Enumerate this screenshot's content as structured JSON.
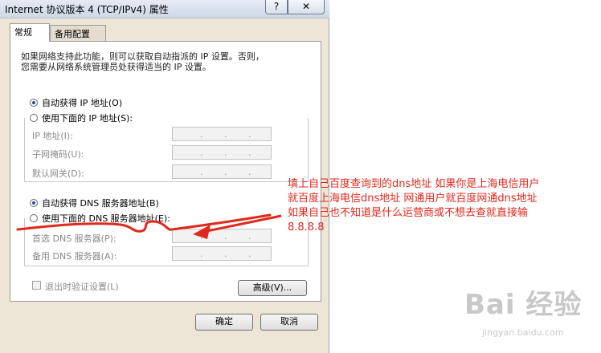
{
  "window": {
    "title": "Internet 协议版本 4 (TCP/IPv4) 属性",
    "help_glyph": "?",
    "close_glyph": "✕"
  },
  "tabs": [
    {
      "label": "常规",
      "active": true
    },
    {
      "label": "备用配置",
      "active": false
    }
  ],
  "description": {
    "line1": "如果网络支持此功能，则可以获取自动指派的 IP 设置。否则，",
    "line2": "您需要从网络系统管理员处获得适当的 IP 设置。"
  },
  "ip_section": {
    "auto_label": "自动获得 IP 地址(O)",
    "auto_selected": true,
    "manual_label": "使用下面的 IP 地址(S):",
    "manual_selected": false,
    "fields": [
      {
        "label": "IP 地址(I):"
      },
      {
        "label": "子网掩码(U):"
      },
      {
        "label": "默认网关(D):"
      }
    ]
  },
  "dns_section": {
    "auto_label": "自动获得 DNS 服务器地址(B)",
    "auto_selected": true,
    "manual_label": "使用下面的 DNS 服务器地址(E):",
    "manual_selected": false,
    "fields": [
      {
        "label": "首选 DNS 服务器(P):"
      },
      {
        "label": "备用 DNS 服务器(A):"
      }
    ]
  },
  "validate": {
    "label": "退出时验证设置(L)",
    "checked": false
  },
  "buttons": {
    "advanced": "高级(V)...",
    "ok": "确定",
    "cancel": "取消"
  },
  "ip_dot": ".",
  "annotation": {
    "color": "#e0281c",
    "lines": [
      "填上自己百度查询到的dns地址 如果你是上海电信用户",
      "就百度上海电信dns地址 网通用户就百度网通dns地址",
      "如果自己也不知道是什么运营商或不想去查就直接输",
      "8.8.8.8"
    ]
  },
  "watermark": {
    "main": "Bai 经验",
    "sub": "jingyan.baidu.com"
  }
}
